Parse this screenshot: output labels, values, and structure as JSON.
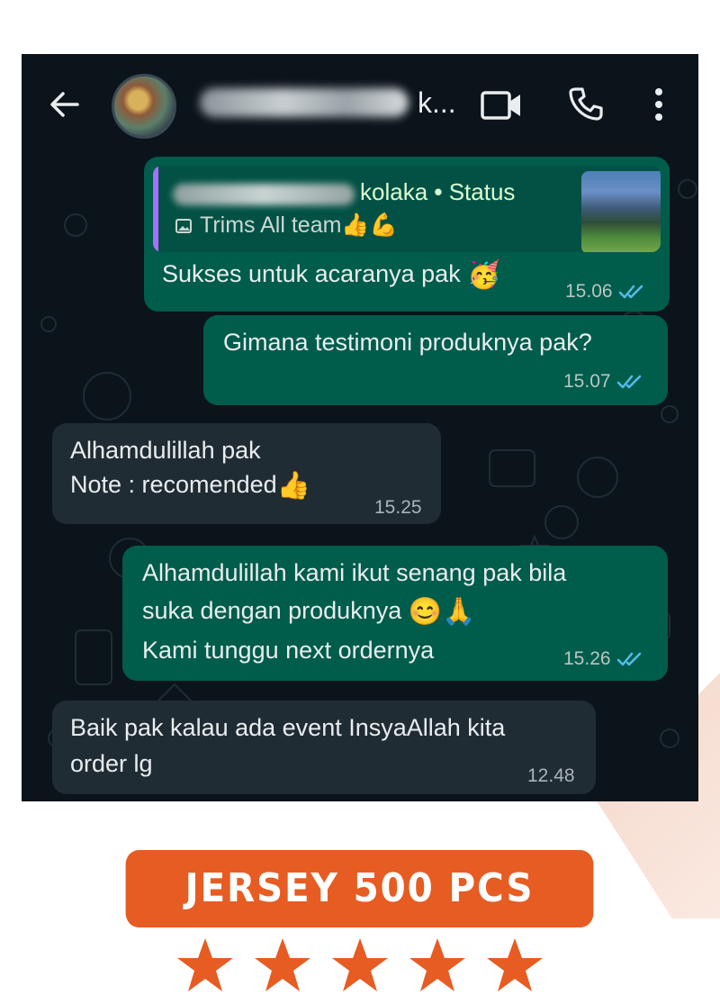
{
  "header": {
    "contact_name_visible": "k...",
    "contact_name_blurred": true,
    "icons": [
      "back-arrow-icon",
      "video-call-icon",
      "voice-call-icon",
      "more-options-icon"
    ]
  },
  "messages": [
    {
      "direction": "outgoing",
      "reply": {
        "author_suffix": "kolaka",
        "context": "Status",
        "quoted_text": "Trims All team"
      },
      "lines": [
        "Sukses untuk acaranya pak"
      ],
      "time": "15.06",
      "status": "read"
    },
    {
      "direction": "outgoing",
      "lines": [
        "Gimana testimoni produknya pak?"
      ],
      "time": "15.07",
      "status": "read"
    },
    {
      "direction": "incoming",
      "lines": [
        "Alhamdulillah pak",
        "Note : recomended"
      ],
      "time": "15.25"
    },
    {
      "direction": "outgoing",
      "lines": [
        "Alhamdulillah kami ikut senang pak bila",
        "suka dengan produknya",
        "Kami tunggu next ordernya"
      ],
      "time": "15.26",
      "status": "read"
    },
    {
      "direction": "incoming",
      "lines": [
        "Baik pak kalau ada event InsyaAllah kita",
        "order lg"
      ],
      "time": "12.48"
    }
  ],
  "banner": {
    "title": "JERSEY 500 PCS",
    "rating": 5,
    "max_rating": 5
  },
  "colors": {
    "chat_background": "#0b141a",
    "outgoing_bubble": "#005c4b",
    "incoming_bubble": "#202c33",
    "read_ticks": "#53bdeb",
    "accent_orange": "#e65c22"
  }
}
